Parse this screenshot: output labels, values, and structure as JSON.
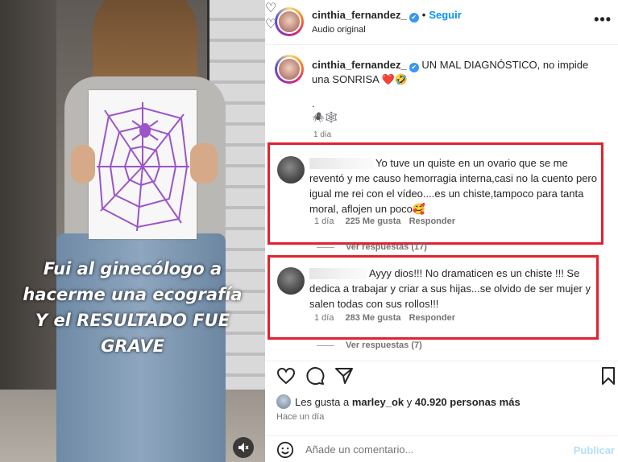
{
  "video": {
    "caption_lines": [
      "Fui al ginecólogo a",
      "hacerme una ecografía",
      "Y el RESULTADO FUE",
      "GRAVE"
    ],
    "mute_icon": "speaker-muted-icon"
  },
  "header": {
    "username": "cinthia_fernandez_",
    "verified_icon": "✔",
    "separator": "•",
    "follow_label": "Seguir",
    "audio_label": "Audio original",
    "more_label": "•••"
  },
  "post_caption": {
    "username": "cinthia_fernandez_",
    "verified_icon": "✔",
    "text": "UN MAL DIAGNÓSTICO, no impide una SONRISA ❤️🤣",
    "dot_line": ".",
    "emoji_line": "🕷️🕸️",
    "age": "1 día"
  },
  "comments": [
    {
      "text": "Yo tuve un quiste en un ovario que se me reventó y me causo hemorragia interna,casi no la cuento pero igual me rei con el vídeo....es un chiste,tampoco para tanta moral, aflojen un poco🥰",
      "age": "1 día",
      "likes": "225 Me gusta",
      "reply": "Responder",
      "view_replies": "Ver respuestas (17)",
      "heart_icon": "♡"
    },
    {
      "text": "Ayyy dios!!! No dramaticen es un chiste !!! Se dedica a trabajar y criar a sus hijas...se olvido de ser mujer y salen todas con sus rollos!!!",
      "age": "1 día",
      "likes": "283 Me gusta",
      "reply": "Responder",
      "view_replies": "Ver respuestas (7)",
      "heart_icon": "♡"
    }
  ],
  "actions": {
    "like_icon": "heart-icon",
    "comment_icon": "comment-icon",
    "share_icon": "share-icon",
    "save_icon": "bookmark-icon"
  },
  "likes_summary": {
    "prefix": "Les gusta a ",
    "user": "marley_ok",
    "middle": " y ",
    "count": "40.920 personas más"
  },
  "time_ago": "Hace un día",
  "comment_input": {
    "placeholder": "Añade un comentario...",
    "publish_label": "Publicar"
  },
  "colors": {
    "accent": "#0095f6",
    "highlight_border": "#e3202f",
    "publish_disabled": "#b2dffc"
  }
}
